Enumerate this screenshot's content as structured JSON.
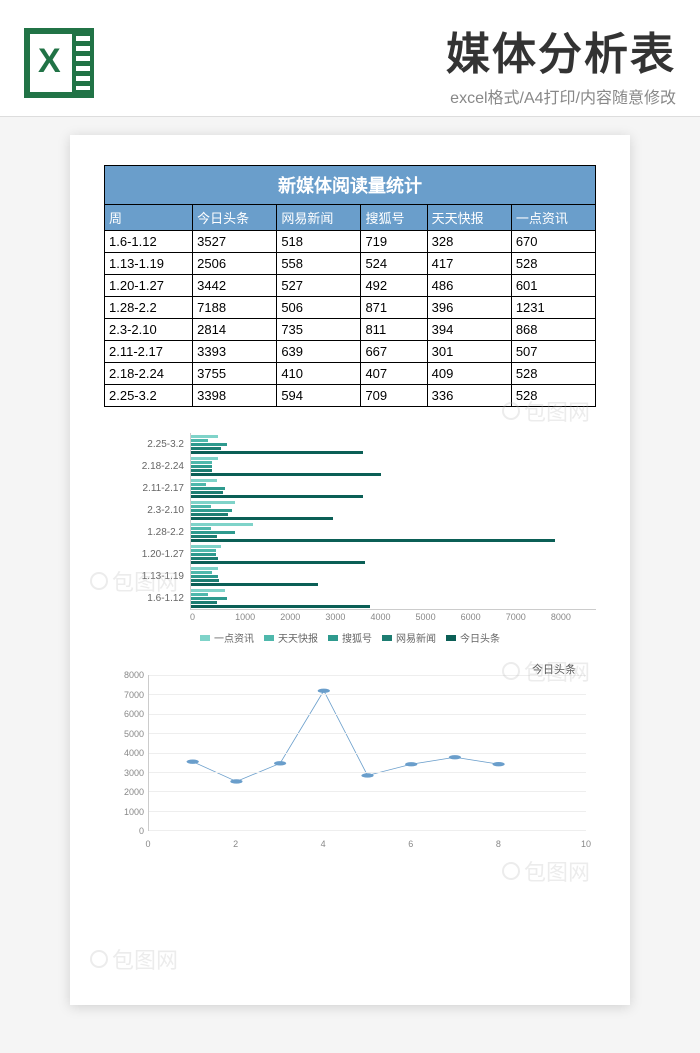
{
  "header": {
    "title": "媒体分析表",
    "subtitle": "excel格式/A4打印/内容随意修改"
  },
  "table": {
    "title": "新媒体阅读量统计",
    "columns": [
      "周",
      "今日头条",
      "网易新闻",
      "搜狐号",
      "天天快报",
      "一点资讯"
    ],
    "rows": [
      [
        "1.6-1.12",
        "3527",
        "518",
        "719",
        "328",
        "670"
      ],
      [
        "1.13-1.19",
        "2506",
        "558",
        "524",
        "417",
        "528"
      ],
      [
        "1.20-1.27",
        "3442",
        "527",
        "492",
        "486",
        "601"
      ],
      [
        "1.28-2.2",
        "7188",
        "506",
        "871",
        "396",
        "1231"
      ],
      [
        "2.3-2.10",
        "2814",
        "735",
        "811",
        "394",
        "868"
      ],
      [
        "2.11-2.17",
        "3393",
        "639",
        "667",
        "301",
        "507"
      ],
      [
        "2.18-2.24",
        "3755",
        "410",
        "407",
        "409",
        "528"
      ],
      [
        "2.25-3.2",
        "3398",
        "594",
        "709",
        "336",
        "528"
      ]
    ]
  },
  "chart_data": [
    {
      "type": "bar",
      "orientation": "horizontal",
      "categories": [
        "1.6-1.12",
        "1.13-1.19",
        "1.20-1.27",
        "1.28-2.2",
        "2.3-2.10",
        "2.11-2.17",
        "2.18-2.24",
        "2.25-3.2"
      ],
      "series": [
        {
          "name": "一点资讯",
          "color": "#7fd3c9",
          "values": [
            670,
            528,
            601,
            1231,
            868,
            507,
            528,
            528
          ]
        },
        {
          "name": "天天快报",
          "color": "#4fb8ac",
          "values": [
            328,
            417,
            486,
            396,
            394,
            301,
            409,
            336
          ]
        },
        {
          "name": "搜狐号",
          "color": "#2e9a8e",
          "values": [
            719,
            524,
            492,
            871,
            811,
            667,
            407,
            709
          ]
        },
        {
          "name": "网易新闻",
          "color": "#1d7d72",
          "values": [
            518,
            558,
            527,
            506,
            735,
            639,
            410,
            594
          ]
        },
        {
          "name": "今日头条",
          "color": "#0b5f56",
          "values": [
            3527,
            2506,
            3442,
            7188,
            2814,
            3393,
            3755,
            3398
          ]
        }
      ],
      "xlim": [
        0,
        8000
      ],
      "xticks": [
        0,
        1000,
        2000,
        3000,
        4000,
        5000,
        6000,
        7000,
        8000
      ],
      "legend_position": "bottom"
    },
    {
      "type": "line",
      "title": "今日头条",
      "x": [
        1,
        2,
        3,
        4,
        5,
        6,
        7,
        8
      ],
      "values": [
        3527,
        2506,
        3442,
        7188,
        2814,
        3393,
        3755,
        3398
      ],
      "xlim": [
        0,
        10
      ],
      "ylim": [
        0,
        8000
      ],
      "yticks": [
        0,
        1000,
        2000,
        3000,
        4000,
        5000,
        6000,
        7000,
        8000
      ],
      "xticks": [
        0,
        2,
        4,
        6,
        8,
        10
      ],
      "color": "#6a9ecb"
    }
  ],
  "watermark": "包图网"
}
